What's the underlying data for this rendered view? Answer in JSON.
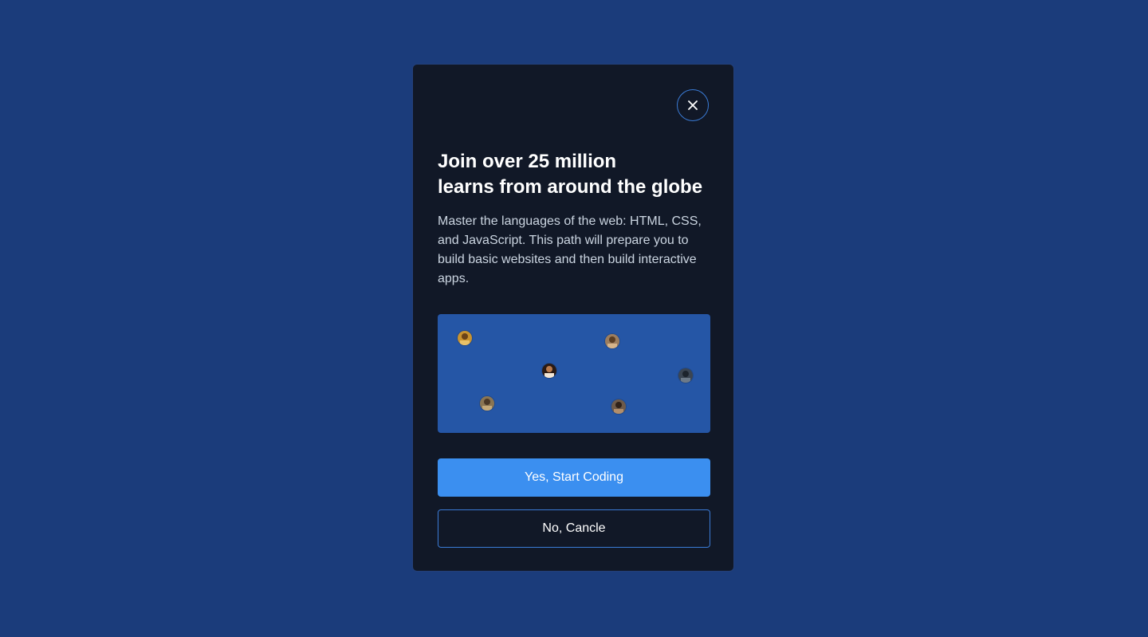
{
  "modal": {
    "close_icon": "close-icon",
    "title_line1": "Join over 25 million",
    "title_line2": "learns from around the globe",
    "description": "Master the languages of the web: HTML, CSS, and JavaScript. This path will prepare you to build basic websites and then build interactive apps.",
    "primary_button": "Yes, Start Coding",
    "secondary_button": "No, Cancle"
  },
  "colors": {
    "page_background": "#1b3c7b",
    "modal_background": "#111827",
    "map_background": "#2556a6",
    "primary_button": "#3b8ff0",
    "border_accent": "#3a7bd5"
  }
}
